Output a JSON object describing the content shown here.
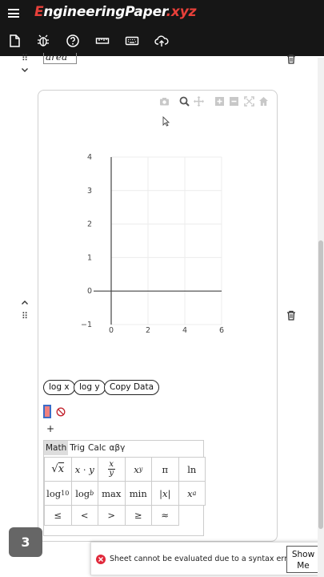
{
  "app": {
    "brand_prefix": "E",
    "brand_main": "ngineeringPaper",
    "brand_suffix": ".xyz"
  },
  "toolbar": {
    "icons": [
      "new-sheet-icon",
      "bug-icon",
      "help-icon",
      "ruler-icon",
      "keyboard-icon",
      "upload-icon"
    ]
  },
  "cell_previous": {
    "field_text": "area ="
  },
  "plot": {
    "modebar_icons": [
      "camera-icon",
      "zoom-icon",
      "pan-icon",
      "zoom-in-icon",
      "zoom-out-icon",
      "autoscale-icon",
      "home-icon"
    ],
    "buttons": {
      "log_x": "log x",
      "log_y": "log y",
      "copy_data": "Copy Data"
    }
  },
  "chart_data": {
    "type": "line",
    "series": [],
    "xlim": [
      0,
      6
    ],
    "ylim": [
      -1,
      4
    ],
    "x_ticks": [
      "0",
      "2",
      "4",
      "6"
    ],
    "y_ticks": [
      "4",
      "3",
      "2",
      "1",
      "0",
      "−1"
    ],
    "grid": true
  },
  "keyboard": {
    "tabs": [
      "Math",
      "Trig",
      "Calc",
      "αβγ"
    ],
    "active_tab": "Math",
    "keys": [
      [
        "√x",
        "x · y",
        "x/y",
        "xʸ",
        "π",
        "ln"
      ],
      [
        "log₁₀",
        "log_b",
        "max",
        "min",
        "|x|",
        "xₐ"
      ],
      [
        "≤",
        "<",
        ">",
        "≥",
        "≈"
      ]
    ]
  },
  "add_button": "+",
  "badge": {
    "count": "3"
  },
  "toast": {
    "message": "Sheet cannot be evaluated due to a syntax error.",
    "button_line1": "Show",
    "button_line2": "Me",
    "error_color": "#e0283a"
  },
  "colors": {
    "header_bg": "#161616",
    "brand_accent": "#e8403a",
    "cursor_fill": "#f08080"
  }
}
